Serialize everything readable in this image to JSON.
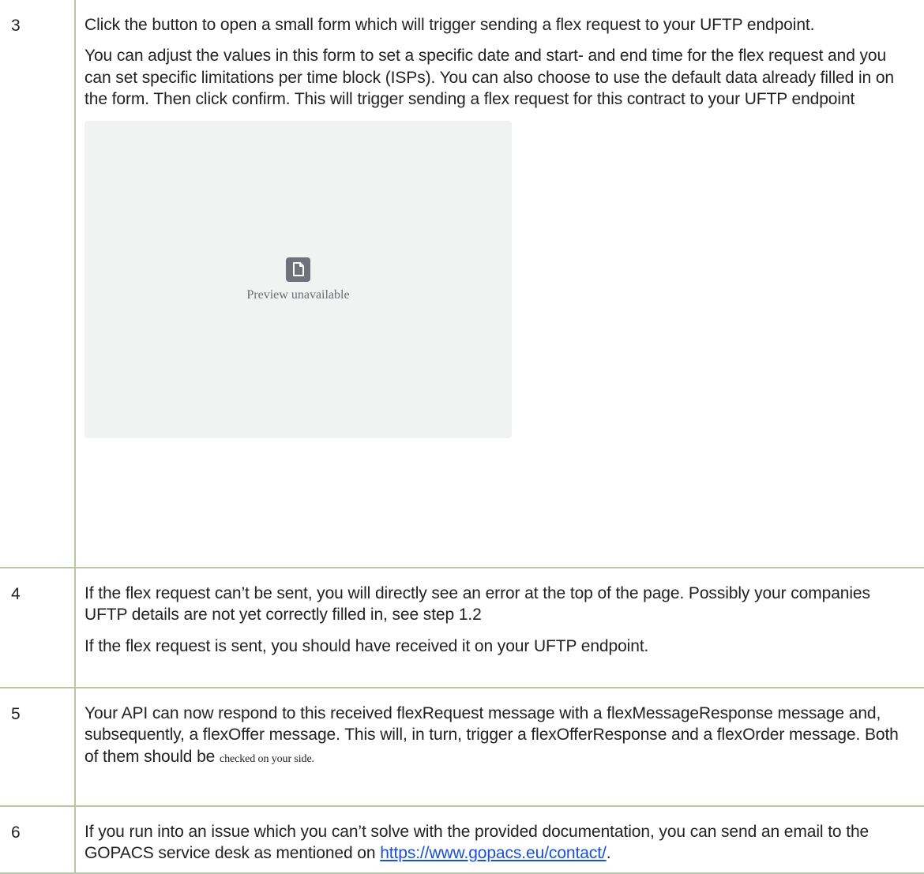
{
  "rows": [
    {
      "num": "3",
      "paragraphs": [
        "Click the button to open a small form which will trigger sending a flex request to your UFTP endpoint.",
        "You can adjust the values in this form to set a specific date and start- and end time for the flex request and you can set specific limitations per time block (ISPs). You can also choose to use the default data already filled in on the form. Then click confirm. This will trigger sending a flex request for this contract to your UFTP endpoint"
      ],
      "preview": {
        "caption": "Preview unavailable",
        "icon": "document-icon"
      }
    },
    {
      "num": "4",
      "paragraphs": [
        "If the flex request can’t be sent, you will directly see an error at the top of the page. Possibly your companies UFTP details are not yet correctly filled in, see step 1.2",
        "If the flex request is sent, you should have received it on your UFTP endpoint."
      ]
    },
    {
      "num": "5",
      "text_main": "Your API can now respond to this received flexRequest message with a flexMessageResponse message and, subsequently, a flexOffer message. This will, in turn, trigger a flexOfferResponse and a flexOrder message. Both of them should be ",
      "text_small": "checked on your side."
    },
    {
      "num": "6",
      "text_main": "If you run into an issue which you can’t solve with the provided documentation, you can send an email to the GOPACS service desk as mentioned on ",
      "link": "https://www.gopacs.eu/contact/",
      "text_end": "."
    }
  ],
  "colors": {
    "border": "#b9c8a0",
    "link": "#1a4fd6",
    "preview_bg": "#f1f2f2"
  }
}
